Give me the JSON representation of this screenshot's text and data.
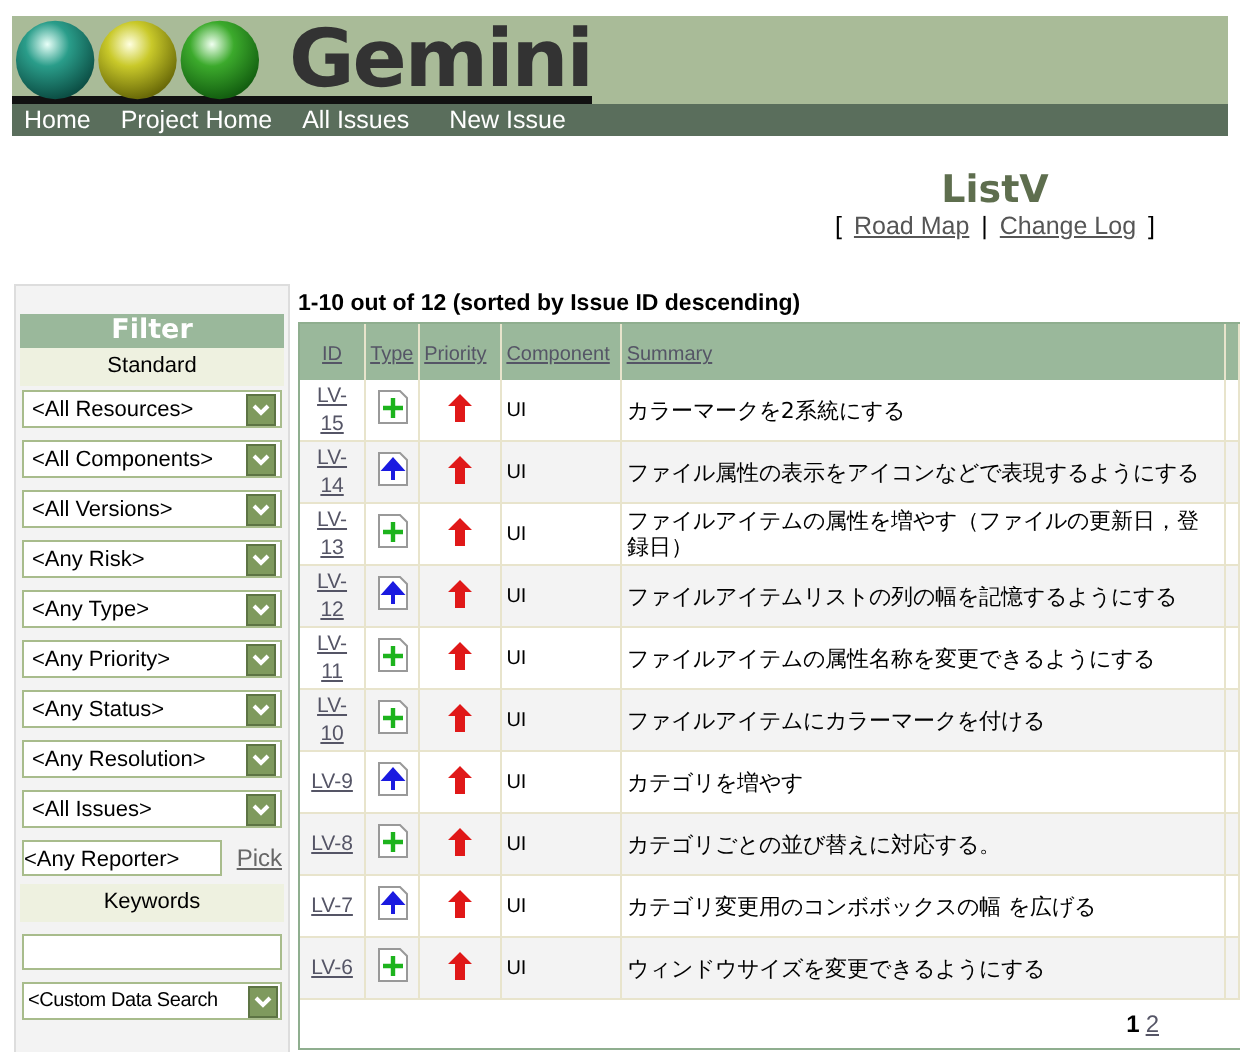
{
  "logo": {
    "text": "Gemini"
  },
  "nav": [
    "Home",
    "Project Home",
    "All Issues",
    "New Issue"
  ],
  "project": {
    "title": "ListV",
    "open": "[",
    "separator": "|",
    "close": "]",
    "links": [
      "Road Map",
      "Change Log"
    ]
  },
  "filter": {
    "title": "Filter",
    "standard_label": "Standard",
    "selects": [
      "<All Resources>",
      "<All Components>",
      "<All Versions>",
      "<Any Risk>",
      "<Any Type>",
      "<Any Priority>",
      "<Any Status>",
      "<Any Resolution>",
      "<All Issues>"
    ],
    "reporter": {
      "value": "<Any Reporter>",
      "pick": "Pick"
    },
    "keywords_label": "Keywords",
    "custom_search": "<Custom Data Search"
  },
  "results": {
    "summary": "1-10 out of 12 (sorted by Issue ID descending)",
    "columns": [
      "ID",
      "Type",
      "Priority",
      "Component",
      "Summary"
    ],
    "rows": [
      {
        "id": "LV-15",
        "kind": "plus",
        "component": "UI",
        "summary": "カラーマークを2系統にする"
      },
      {
        "id": "LV-14",
        "kind": "arrow",
        "component": "UI",
        "summary": "ファイル属性の表示をアイコンなどで表現するようにする"
      },
      {
        "id": "LV-13",
        "kind": "plus",
        "component": "UI",
        "summary": "ファイルアイテムの属性を増やす（ファイルの更新日，登録日）"
      },
      {
        "id": "LV-12",
        "kind": "arrow",
        "component": "UI",
        "summary": "ファイルアイテムリストの列の幅を記憶するようにする"
      },
      {
        "id": "LV-11",
        "kind": "plus",
        "component": "UI",
        "summary": "ファイルアイテムの属性名称を変更できるようにする"
      },
      {
        "id": "LV-10",
        "kind": "plus",
        "component": "UI",
        "summary": "ファイルアイテムにカラーマークを付ける"
      },
      {
        "id": "LV-9",
        "kind": "arrow",
        "component": "UI",
        "summary": "カテゴリを増やす"
      },
      {
        "id": "LV-8",
        "kind": "plus",
        "component": "UI",
        "summary": "カテゴリごとの並び替えに対応する。"
      },
      {
        "id": "LV-7",
        "kind": "arrow",
        "component": "UI",
        "summary": "カテゴリ変更用のコンボボックスの幅 を広げる"
      },
      {
        "id": "LV-6",
        "kind": "plus",
        "component": "UI",
        "summary": "ウィンドウサイズを変更できるようにする"
      }
    ],
    "pages": [
      {
        "label": "1",
        "selected": true
      },
      {
        "label": "2",
        "selected": false
      }
    ]
  }
}
